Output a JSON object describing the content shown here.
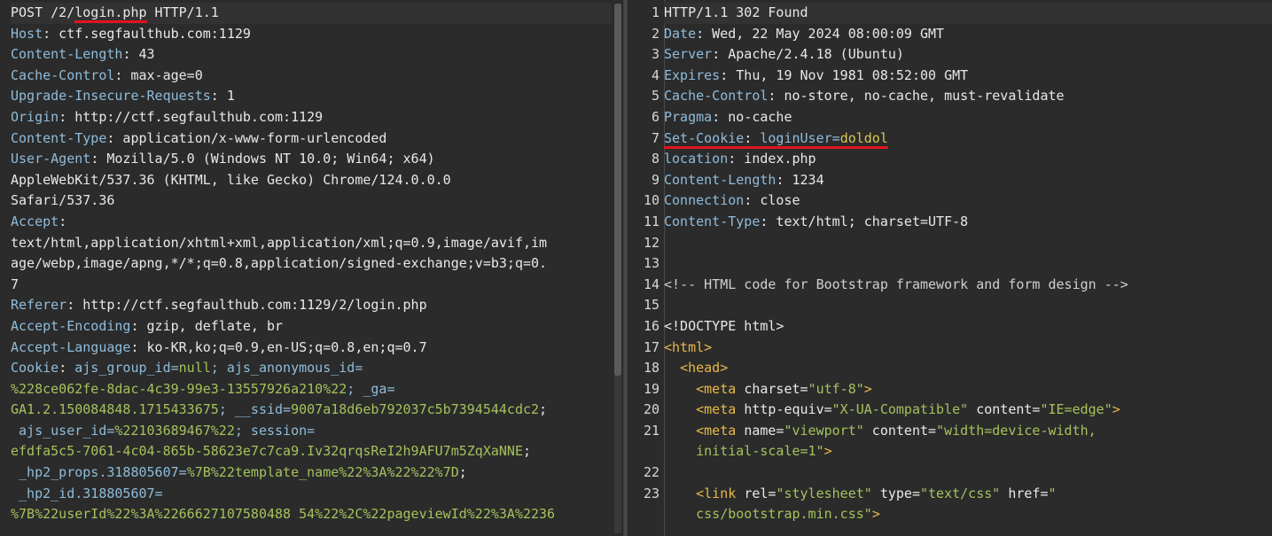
{
  "request": {
    "request_line": {
      "method": "POST /2/",
      "path": "login.php",
      "proto": " HTTP/1.1"
    },
    "headers": [
      {
        "k": "Host",
        "v": " ctf.segfaulthub.com:1129"
      },
      {
        "k": "Content-Length",
        "v": " 43"
      },
      {
        "k": "Cache-Control",
        "v": " max-age=0"
      },
      {
        "k": "Upgrade-Insecure-Requests",
        "v": " 1"
      },
      {
        "k": "Origin",
        "v": " http://ctf.segfaulthub.com:1129"
      },
      {
        "k": "Content-Type",
        "v": " application/x-www-form-urlencoded"
      },
      {
        "k": "User-Agent",
        "v": " Mozilla/5.0 (Windows NT 10.0; Win64; x64)"
      }
    ],
    "ua_cont_1": "AppleWebKit/537.36 (KHTML, like Gecko) Chrome/124.0.0.0",
    "ua_cont_2": "Safari/537.36",
    "accept_key": "Accept",
    "accept_cont_1": "text/html,application/xhtml+xml,application/xml;q=0.9,image/avif,im",
    "accept_cont_2": "age/webp,image/apng,*/*;q=0.8,application/signed-exchange;v=b3;q=0.",
    "accept_cont_3": "7",
    "headers2": [
      {
        "k": "Referer",
        "v": " http://ctf.segfaulthub.com:1129/2/login.php"
      },
      {
        "k": "Accept-Encoding",
        "v": " gzip, deflate, br"
      },
      {
        "k": "Accept-Language",
        "v": " ko-KR,ko;q=0.9,en-US;q=0.8,en;q=0.7"
      }
    ],
    "cookie_key": "Cookie",
    "cookie_l1_a": " ajs_group_id=",
    "cookie_l1_b": "null",
    "cookie_l1_c": "; ajs_anonymous_id=",
    "cookie_l2_a": "%228ce062fe-8dac-4c39-99e3-13557926a210%22",
    "cookie_l2_b": "; _ga=",
    "cookie_l3_a": "GA1.2.150084848.1715433675",
    "cookie_l3_b": "; __ssid=",
    "cookie_l3_c": "9007a18d6eb792037c5b7394544cdc2",
    "cookie_l3_d": ";",
    "cookie_l4_a": " ajs_user_id=",
    "cookie_l4_b": "%22103689467%22",
    "cookie_l4_c": "; session=",
    "cookie_l5_a": "efdfa5c5-7061-4c04-865b-58623e7c7ca9.Iv32qrqsReI2h9AFU7m5ZqXaNNE",
    "cookie_l5_b": ";",
    "cookie_l6_a": " _hp2_props.318805607=",
    "cookie_l6_b": "%7B%22template_name%22%3A%22%22%7D",
    "cookie_l6_c": ";",
    "cookie_l7_a": " _hp2_id.318805607=",
    "cookie_l8_a": "%7B%22userId%22%3A%2266627107580488 54%22%2C%22pageviewId%22%3A%2236"
  },
  "response": {
    "line_numbers": [
      "1",
      "2",
      "3",
      "4",
      "5",
      "6",
      "7",
      "8",
      "9",
      "10",
      "11",
      "12",
      "13",
      "14",
      "15",
      "16",
      "17",
      "18",
      "19",
      "20",
      "21",
      "",
      "22",
      "23"
    ],
    "status": "HTTP/1.1 302 Found",
    "headers": [
      {
        "k": "Date",
        "v": " Wed, 22 May 2024 08:00:09 GMT"
      },
      {
        "k": "Server",
        "v": " Apache/2.4.18 (Ubuntu)"
      },
      {
        "k": "Expires",
        "v": " Thu, 19 Nov 1981 08:52:00 GMT"
      },
      {
        "k": "Cache-Control",
        "v": " no-store, no-cache, must-revalidate"
      },
      {
        "k": "Pragma",
        "v": " no-cache"
      }
    ],
    "set_cookie_key": "Set-Cookie",
    "set_cookie_name": " loginUser=",
    "set_cookie_value": "doldol",
    "headers2": [
      {
        "k": "location",
        "v": " index.php"
      },
      {
        "k": "Content-Length",
        "v": " 1234"
      },
      {
        "k": "Connection",
        "v": " close"
      },
      {
        "k": "Content-Type",
        "v": " text/html; charset=UTF-8"
      }
    ],
    "comment": "<!-- HTML code for Bootstrap framework and form design -->",
    "doctype": "<!DOCTYPE html>",
    "html_open": "<html>",
    "head_open": "<head>",
    "meta1": {
      "tag": "<meta ",
      "attr": "charset=",
      "val": "\"utf-8\"",
      "end": ">"
    },
    "meta2": {
      "tag": "<meta ",
      "attr1": "http-equiv=",
      "val1": "\"X-UA-Compatible\"",
      "attr2": " content=",
      "val2": "\"IE=edge\"",
      "end": ">"
    },
    "meta3": {
      "tag": "<meta ",
      "attr1": "name=",
      "val1": "\"viewport\"",
      "attr2": " content=",
      "val2": "\"width=device-width,",
      "cont": "initial-scale=1\"",
      "end": ">"
    },
    "link": {
      "tag": "<link ",
      "attr1": "rel=",
      "val1": "\"stylesheet\"",
      "attr2": " type=",
      "val2": "\"text/css\"",
      "attr3": " href=",
      "val3": "\"",
      "cont": "css/bootstrap.min.css\"",
      "end": ">"
    }
  }
}
